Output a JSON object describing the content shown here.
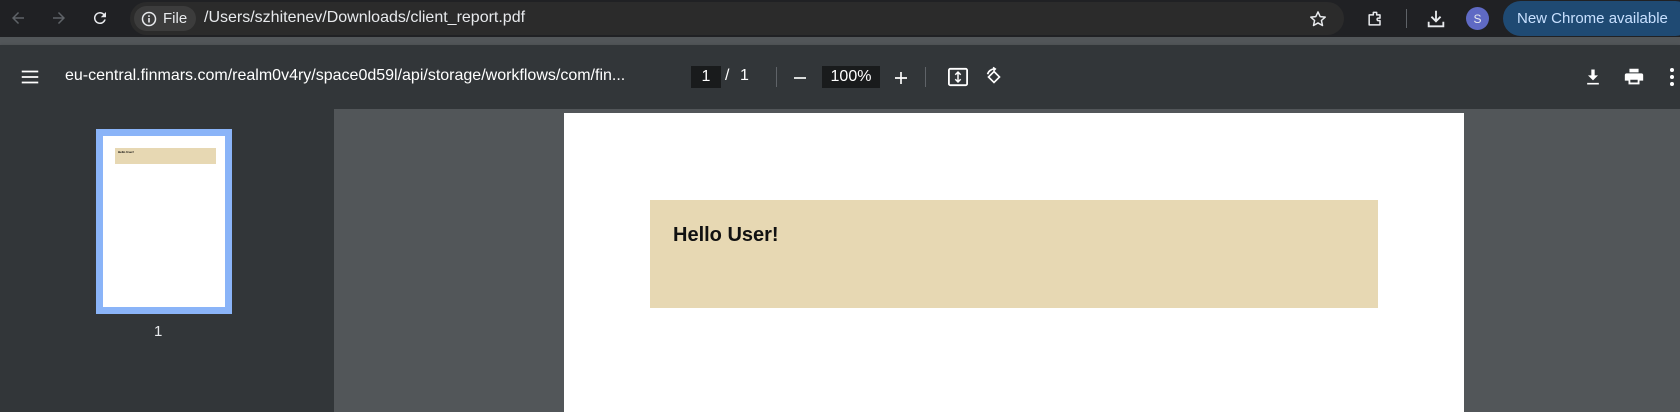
{
  "browser": {
    "file_chip": "File",
    "address": "/Users/szhitenev/Downloads/client_report.pdf",
    "avatar_initial": "S",
    "update_label": "New Chrome available",
    "update_color": "#1f4a73"
  },
  "pdf_toolbar": {
    "title": "eu-central.finmars.com/realm0v4ry/space0d59l/api/storage/workflows/com/fin...",
    "current_page": "1",
    "page_separator": "/",
    "total_pages": "1",
    "zoom": "100%"
  },
  "sidebar": {
    "thumbnail_label": "1",
    "thumbnail_text": "Hello User!",
    "selection_color": "#8ab4f8"
  },
  "document": {
    "heading": "Hello User!",
    "band_color": "#e7d8b3"
  },
  "icons": [
    "back-arrow-icon",
    "forward-arrow-icon",
    "reload-icon",
    "info-icon",
    "star-icon",
    "extensions-icon",
    "download-icon",
    "menu-icon",
    "zoom-out-icon",
    "zoom-in-icon",
    "fit-page-icon",
    "rotate-icon",
    "pdf-download-icon",
    "print-icon",
    "more-vert-icon"
  ]
}
